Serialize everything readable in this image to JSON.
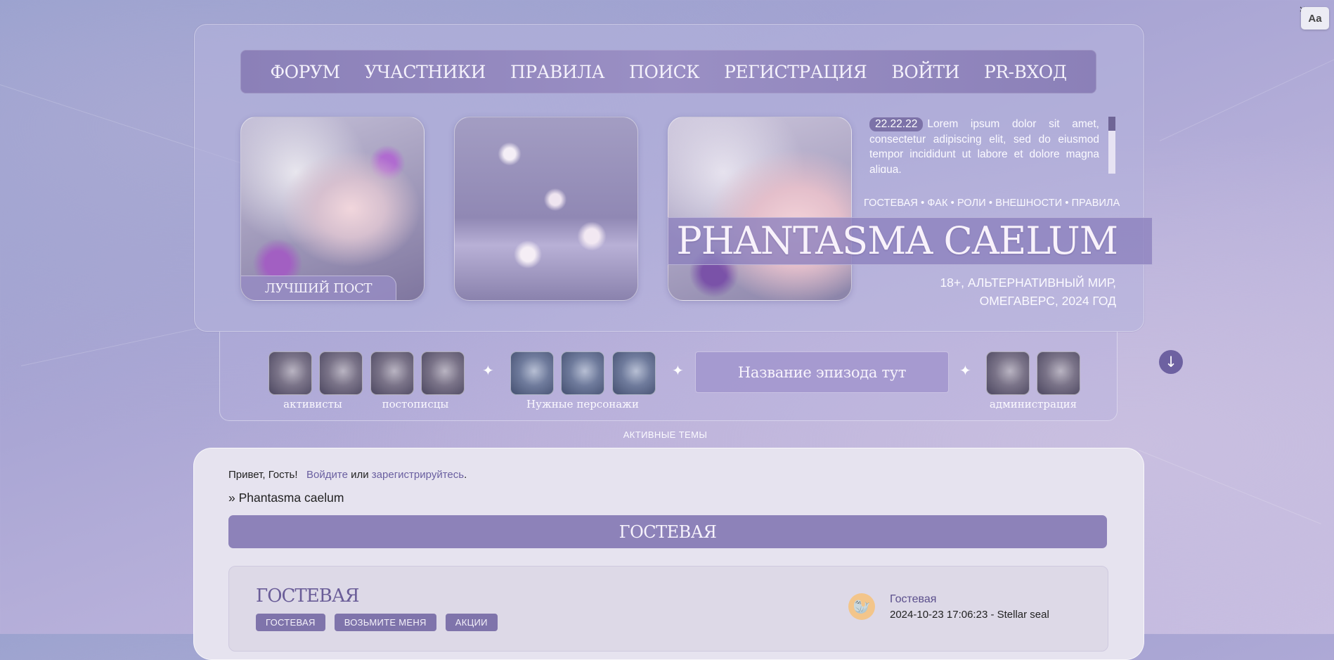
{
  "font_toggle": {
    "label": "Aa",
    "close": "×"
  },
  "nav": {
    "items": [
      "ФОРУМ",
      "УЧАСТНИКИ",
      "ПРАВИЛА",
      "ПОИСК",
      "РЕГИСТРАЦИЯ",
      "ВОЙТИ",
      "PR-ВХОД"
    ]
  },
  "header": {
    "best_post": "ЛУЧШИЙ ПОСТ",
    "news_date": "22.22.22",
    "news_text": "Lorem ipsum dolor sit amet, consectetur adipiscing elit, sed do eiusmod tempor incididunt ut labore et dolore magna aliqua.",
    "quicklinks": "ГОСТЕВАЯ • ФАК • РОЛИ • ВНЕШНОСТИ • ПРАВИЛА",
    "site_title": "PHANTASMA CAELUM",
    "subtitle_line1": "18+, АЛЬТЕРНАТИВНЫЙ МИР,",
    "subtitle_line2": "ОМЕГАВЕРС, 2024 ГОД"
  },
  "strip": {
    "label_activists": "активисты",
    "label_posters": "постописцы",
    "label_needed": "Нужные персонажи",
    "episode": "Название эпизода тут",
    "label_admins": "администрация",
    "sparkle": "✦",
    "down": "↓"
  },
  "active_topics": "АКТИВНЫЕ ТЕМЫ",
  "content": {
    "greet_hello": "Привет, Гость!",
    "greet_login": "Войдите",
    "greet_or": "или",
    "greet_register": "зарегистрируйтесь",
    "greet_dot": ".",
    "breadcrumb": "» Phantasma caelum",
    "forum_band": "ГОСТЕВАЯ",
    "topic": {
      "title": "ГОСТЕВАЯ",
      "tags": [
        "ГОСТЕВАЯ",
        "ВОЗЬМИТЕ МЕНЯ",
        "АКЦИИ"
      ],
      "last_forum": "Гостевая",
      "last_meta": "2024-10-23 17:06:23 - Stellar seal",
      "avatar_icon": "seal-avatar-icon"
    }
  },
  "colors": {
    "accent": "#8d82b9",
    "dark_accent": "#6d61a1",
    "background": "#a7a4d3"
  }
}
